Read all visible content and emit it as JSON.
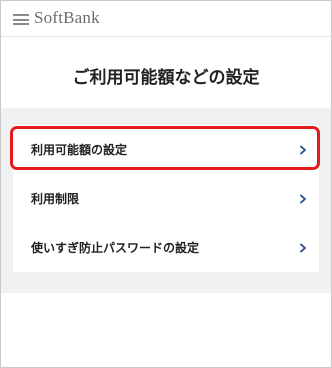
{
  "header": {
    "logo_text": "SoftBank"
  },
  "page": {
    "title": "ご利用可能額などの設定"
  },
  "menu": {
    "items": [
      {
        "label": "利用可能額の設定",
        "highlighted": true
      },
      {
        "label": "利用制限",
        "highlighted": false
      },
      {
        "label": "使いすぎ防止パスワードの設定",
        "highlighted": false
      }
    ]
  },
  "colors": {
    "highlight_border": "#e41c1c",
    "chevron": "#1f4a8a",
    "section_background": "#f1f1f1"
  },
  "icons": {
    "menu": "hamburger-menu-icon",
    "item_arrow": "chevron-right-icon"
  }
}
